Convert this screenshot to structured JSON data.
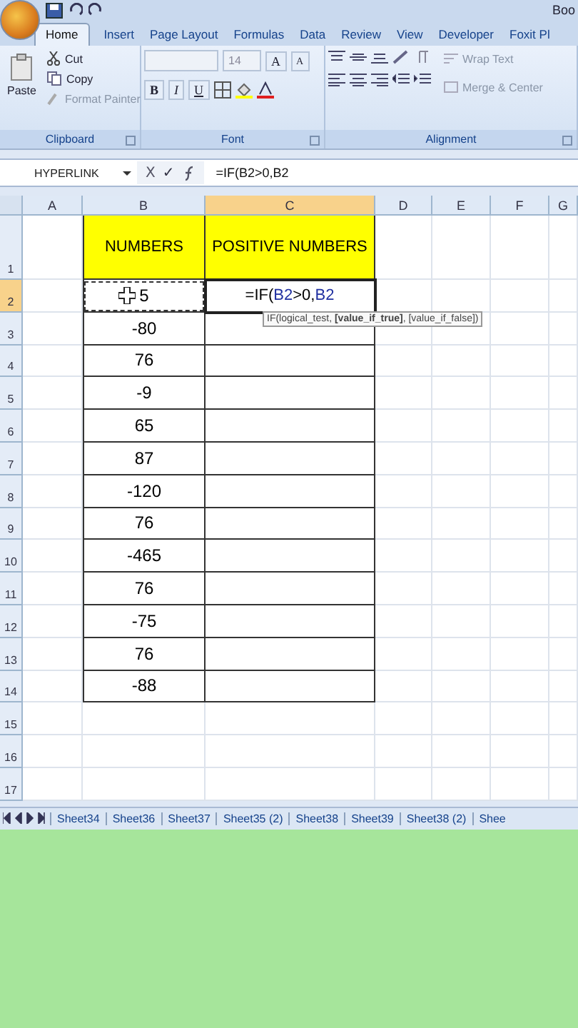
{
  "title_bar": {
    "title": "Boo"
  },
  "tabs": [
    {
      "label": "Home",
      "selected": true
    },
    {
      "label": "Insert",
      "selected": false
    },
    {
      "label": "Page Layout",
      "selected": false
    },
    {
      "label": "Formulas",
      "selected": false
    },
    {
      "label": "Data",
      "selected": false
    },
    {
      "label": "Review",
      "selected": false
    },
    {
      "label": "View",
      "selected": false
    },
    {
      "label": "Developer",
      "selected": false
    },
    {
      "label": "Foxit Pl",
      "selected": false
    }
  ],
  "clipboard": {
    "label": "Clipboard",
    "paste": "Paste",
    "cut": "Cut",
    "copy": "Copy",
    "format_painter": "Format Painter"
  },
  "font": {
    "label": "Font",
    "size": "14",
    "grow": "A",
    "shrink": "A",
    "bold": "B",
    "italic": "I",
    "underline": "U"
  },
  "alignment": {
    "label": "Alignment",
    "wrap_text": "Wrap Text",
    "merge": "Merge & Center"
  },
  "formula_bar": {
    "name_box": "HYPERLINK",
    "cancel": "X",
    "enter": "✓",
    "formula": "=IF(B2>0,B2"
  },
  "columns": [
    {
      "label": "A",
      "selected": false
    },
    {
      "label": "B",
      "selected": false
    },
    {
      "label": "C",
      "selected": true
    },
    {
      "label": "D",
      "selected": false
    },
    {
      "label": "E",
      "selected": false
    },
    {
      "label": "F",
      "selected": false
    },
    {
      "label": "G",
      "selected": false
    }
  ],
  "rows": [
    {
      "label": "1",
      "selected": false,
      "kind": "header",
      "b": "NUMBERS",
      "c": "POSITIVE NUMBERS"
    },
    {
      "label": "2",
      "selected": true,
      "kind": "active",
      "b": "5",
      "c_parts": [
        {
          "text": "=IF(",
          "kind": "plain"
        },
        {
          "text": "B2",
          "kind": "ref"
        },
        {
          "text": ">0,",
          "kind": "plain"
        },
        {
          "text": "B2",
          "kind": "ref"
        }
      ]
    },
    {
      "label": "3",
      "selected": false,
      "kind": "data",
      "b": "-80"
    },
    {
      "label": "4",
      "selected": false,
      "kind": "data",
      "b": "76"
    },
    {
      "label": "5",
      "selected": false,
      "kind": "data",
      "b": "-9"
    },
    {
      "label": "6",
      "selected": false,
      "kind": "data",
      "b": "65"
    },
    {
      "label": "7",
      "selected": false,
      "kind": "data",
      "b": "87"
    },
    {
      "label": "8",
      "selected": false,
      "kind": "data",
      "b": "-120"
    },
    {
      "label": "9",
      "selected": false,
      "kind": "data",
      "b": "76"
    },
    {
      "label": "10",
      "selected": false,
      "kind": "data",
      "b": "-465"
    },
    {
      "label": "11",
      "selected": false,
      "kind": "data",
      "b": "76"
    },
    {
      "label": "12",
      "selected": false,
      "kind": "data",
      "b": "-75"
    },
    {
      "label": "13",
      "selected": false,
      "kind": "data",
      "b": "76"
    },
    {
      "label": "14",
      "selected": false,
      "kind": "data",
      "b": "-88"
    },
    {
      "label": "15",
      "selected": false,
      "kind": "empty"
    },
    {
      "label": "16",
      "selected": false,
      "kind": "empty"
    },
    {
      "label": "17",
      "selected": false,
      "kind": "empty"
    }
  ],
  "tooltip": "IF(logical_test, **[value_if_true]**, [value_if_false])",
  "sheet_tabs": [
    {
      "label": "Sheet34",
      "selected": false
    },
    {
      "label": "Sheet36",
      "selected": false
    },
    {
      "label": "Sheet37",
      "selected": false
    },
    {
      "label": "Sheet35 (2)",
      "selected": false
    },
    {
      "label": "Sheet38",
      "selected": false
    },
    {
      "label": "Sheet39",
      "selected": false
    },
    {
      "label": "Sheet38 (2)",
      "selected": false
    },
    {
      "label": "Shee",
      "selected": false
    }
  ]
}
